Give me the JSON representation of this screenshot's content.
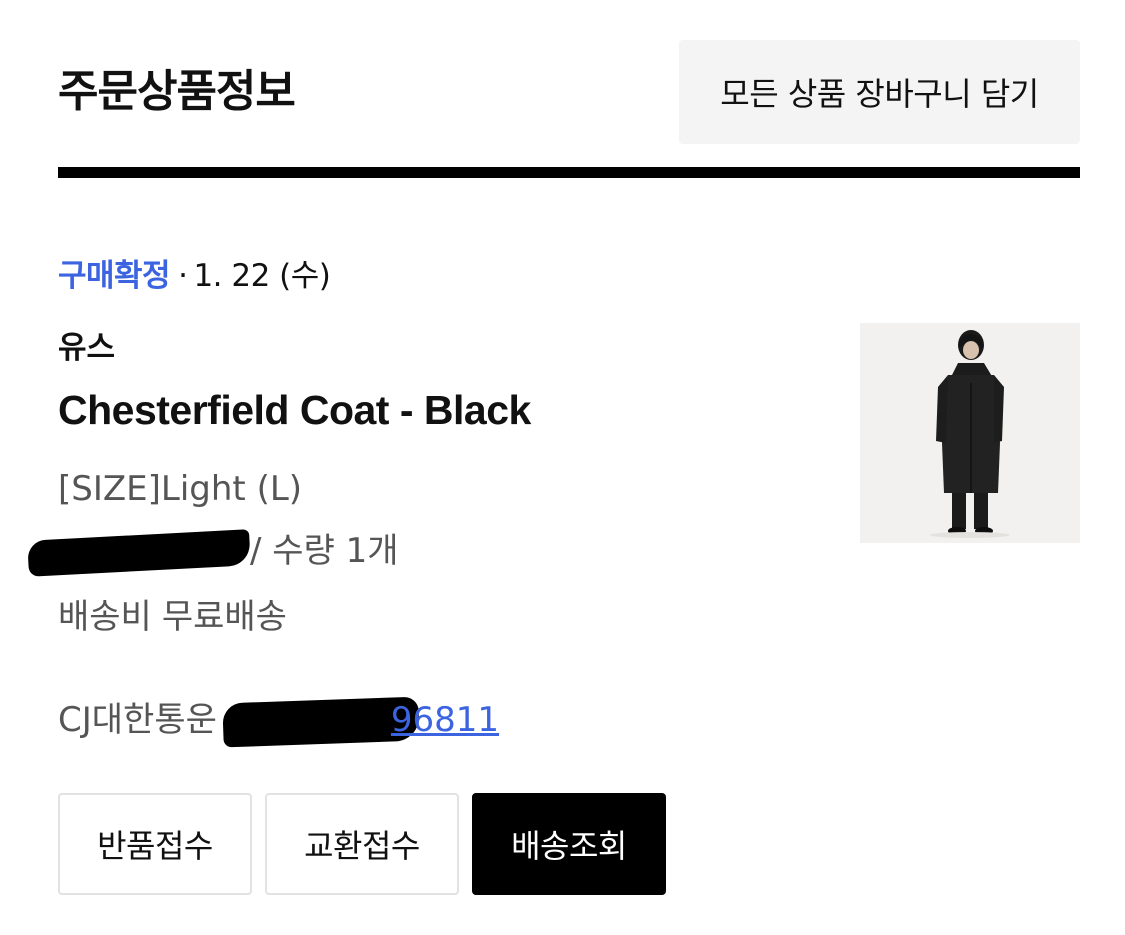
{
  "header": {
    "title": "주문상품정보",
    "cart_all_label": "모든 상품 장바구니 담기"
  },
  "order": {
    "status": "구매확정",
    "separator": "·",
    "date": "1. 22 (수)",
    "brand": "유스",
    "product_name": "Chesterfield Coat - Black",
    "option": "[SIZE]Light (L)",
    "quantity_text": "/ 수량 1개",
    "shipping_label": "배송비",
    "shipping_value": "무료배송",
    "carrier": "CJ대한통운",
    "tracking_visible_suffix": "96811"
  },
  "actions": {
    "return_label": "반품접수",
    "exchange_label": "교환접수",
    "tracking_label": "배송조회"
  },
  "colors": {
    "accent_blue": "#3c64e0",
    "text_primary": "#111111",
    "text_secondary": "#555555",
    "button_bg_gray": "#f4f4f4",
    "divider": "#000000"
  },
  "icons": {
    "product_image": "model-in-black-coat-photo"
  }
}
